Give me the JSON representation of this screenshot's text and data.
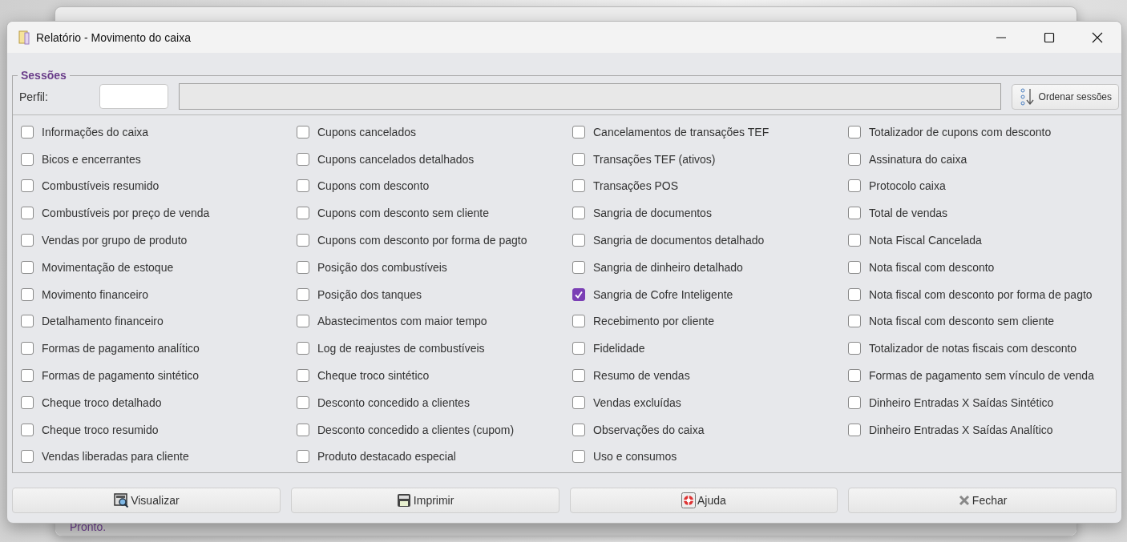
{
  "background_window": {
    "status": "Pronto."
  },
  "window": {
    "title": "Relatório - Movimento do caixa"
  },
  "group": {
    "legend": "Sessões",
    "profile_label": "Perfil:",
    "sort_button": "Ordenar sessões"
  },
  "columns": [
    [
      {
        "label": "Informações do caixa",
        "checked": false
      },
      {
        "label": "Bicos e encerrantes",
        "checked": false
      },
      {
        "label": "Combustíveis resumido",
        "checked": false
      },
      {
        "label": "Combustíveis por preço de venda",
        "checked": false
      },
      {
        "label": "Vendas por grupo de produto",
        "checked": false
      },
      {
        "label": "Movimentação de estoque",
        "checked": false
      },
      {
        "label": "Movimento financeiro",
        "checked": false
      },
      {
        "label": "Detalhamento financeiro",
        "checked": false
      },
      {
        "label": "Formas de pagamento analítico",
        "checked": false
      },
      {
        "label": "Formas de pagamento sintético",
        "checked": false
      },
      {
        "label": "Cheque troco detalhado",
        "checked": false
      },
      {
        "label": "Cheque troco resumido",
        "checked": false
      },
      {
        "label": "Vendas liberadas para cliente",
        "checked": false
      }
    ],
    [
      {
        "label": "Cupons cancelados",
        "checked": false
      },
      {
        "label": "Cupons cancelados detalhados",
        "checked": false
      },
      {
        "label": "Cupons com desconto",
        "checked": false
      },
      {
        "label": "Cupons com desconto sem cliente",
        "checked": false
      },
      {
        "label": "Cupons com desconto por forma de pagto",
        "checked": false
      },
      {
        "label": "Posição dos combustíveis",
        "checked": false
      },
      {
        "label": "Posição dos tanques",
        "checked": false
      },
      {
        "label": "Abastecimentos com maior tempo",
        "checked": false
      },
      {
        "label": "Log de reajustes de combustíveis",
        "checked": false
      },
      {
        "label": "Cheque troco sintético",
        "checked": false
      },
      {
        "label": "Desconto concedido a clientes",
        "checked": false
      },
      {
        "label": "Desconto concedido a clientes (cupom)",
        "checked": false
      },
      {
        "label": "Produto destacado especial",
        "checked": false
      }
    ],
    [
      {
        "label": "Cancelamentos de transações TEF",
        "checked": false
      },
      {
        "label": "Transações TEF (ativos)",
        "checked": false
      },
      {
        "label": "Transações POS",
        "checked": false
      },
      {
        "label": "Sangria de documentos",
        "checked": false
      },
      {
        "label": "Sangria de documentos detalhado",
        "checked": false
      },
      {
        "label": "Sangria de dinheiro detalhado",
        "checked": false
      },
      {
        "label": "Sangria de Cofre Inteligente",
        "checked": true
      },
      {
        "label": "Recebimento por cliente",
        "checked": false
      },
      {
        "label": "Fidelidade",
        "checked": false
      },
      {
        "label": "Resumo de vendas",
        "checked": false
      },
      {
        "label": "Vendas excluídas",
        "checked": false
      },
      {
        "label": "Observações do caixa",
        "checked": false
      },
      {
        "label": "Uso e consumos",
        "checked": false
      }
    ],
    [
      {
        "label": "Totalizador de cupons com desconto",
        "checked": false
      },
      {
        "label": "Assinatura do caixa",
        "checked": false
      },
      {
        "label": "Protocolo caixa",
        "checked": false
      },
      {
        "label": "Total de vendas",
        "checked": false
      },
      {
        "label": "Nota Fiscal Cancelada",
        "checked": false
      },
      {
        "label": "Nota fiscal com desconto",
        "checked": false
      },
      {
        "label": "Nota fiscal com desconto por forma de pagto",
        "checked": false
      },
      {
        "label": "Nota fiscal com desconto sem cliente",
        "checked": false
      },
      {
        "label": "Totalizador de notas fiscais com desconto",
        "checked": false
      },
      {
        "label": "Formas de pagamento sem vínculo de venda",
        "checked": false
      },
      {
        "label": "Dinheiro Entradas X Saídas Sintético",
        "checked": false
      },
      {
        "label": "Dinheiro Entradas X Saídas Analítico",
        "checked": false
      }
    ]
  ],
  "buttons": [
    {
      "label": "Visualizar",
      "kind": "preview"
    },
    {
      "label": "Imprimir",
      "kind": "print"
    },
    {
      "label": "Ajuda",
      "kind": "help"
    },
    {
      "label": "Fechar",
      "kind": "close"
    }
  ]
}
